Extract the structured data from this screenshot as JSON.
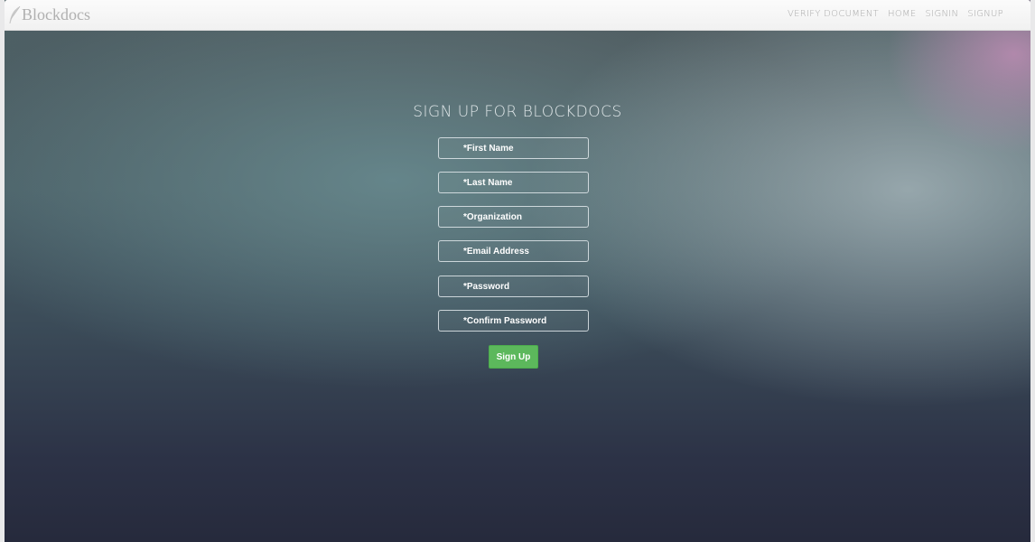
{
  "app": {
    "brand": "Blockdocs"
  },
  "nav": {
    "items": [
      "VERIFY DOCUMENT",
      "HOME",
      "SIGNIN",
      "SIGNUP"
    ]
  },
  "form": {
    "title": "SIGN UP FOR BLOCKDOCS",
    "first_name": {
      "placeholder": "*First Name",
      "value": ""
    },
    "last_name": {
      "placeholder": "*Last Name",
      "value": ""
    },
    "organization": {
      "placeholder": "*Organization",
      "value": ""
    },
    "email": {
      "placeholder": "*Email Address",
      "value": ""
    },
    "password": {
      "placeholder": "*Password",
      "value": ""
    },
    "confirm_password": {
      "placeholder": "*Confirm Password",
      "value": ""
    },
    "submit_label": "Sign Up"
  },
  "colors": {
    "submit_button": "#5cb85c",
    "navbar": "#f5f5f5",
    "nav_text": "#a9a9a9"
  },
  "icons": {
    "brand_logo": "feather-quill-icon"
  }
}
